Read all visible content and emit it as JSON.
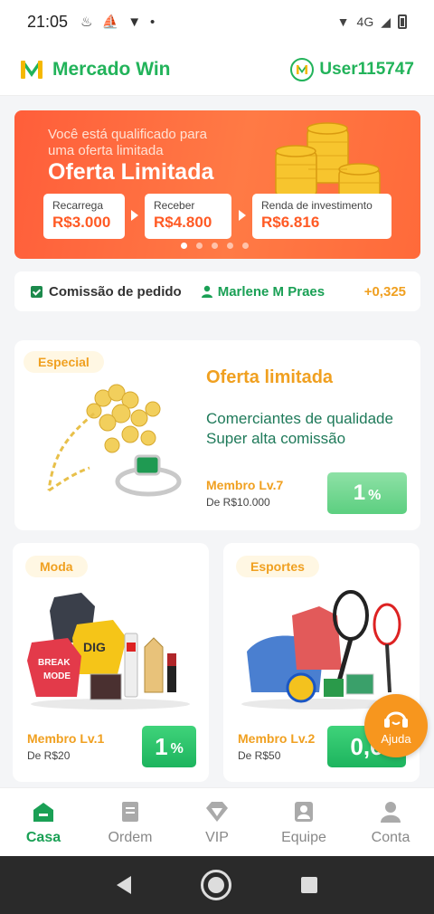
{
  "status_bar": {
    "time": "21:05",
    "network": "4G"
  },
  "header": {
    "app_name": "Mercado Win",
    "username": "User115747",
    "brand_color": "#22b35a"
  },
  "banner": {
    "subtitle": "Você está qualificado para uma oferta limitada",
    "title": "Oferta Limitada",
    "cards": [
      {
        "label": "Recarrega",
        "value": "R$3.000"
      },
      {
        "label": "Receber",
        "value": "R$4.800"
      },
      {
        "label": "Renda de investimento",
        "value": "R$6.816"
      }
    ],
    "dots_count": 5,
    "active_dot": 0
  },
  "commission": {
    "label": "Comissão de pedido",
    "user": "Marlene M Praes",
    "value": "+0,325"
  },
  "featured": {
    "tag": "Especial",
    "title": "Oferta limitada",
    "desc_line1": "Comerciantes de qualidade",
    "desc_line2": "Super alta comissão",
    "level": "Membro Lv.7",
    "min": "De R$10.000",
    "rate": "1",
    "pct": "%"
  },
  "categories": [
    {
      "tag": "Moda",
      "level": "Membro Lv.1",
      "min": "De R$20",
      "rate": "1",
      "pct": "%"
    },
    {
      "tag": "Esportes",
      "level": "Membro Lv.2",
      "min": "De R$50",
      "rate": "0,6"
    }
  ],
  "help": {
    "label": "Ajuda"
  },
  "nav": [
    {
      "label": "Casa",
      "active": true
    },
    {
      "label": "Ordem"
    },
    {
      "label": "VIP"
    },
    {
      "label": "Equipe"
    },
    {
      "label": "Conta"
    }
  ],
  "colors": {
    "accent": "#22b35a",
    "orange": "#ff6a3a",
    "gold": "#f0a020",
    "help": "#f7961e"
  }
}
